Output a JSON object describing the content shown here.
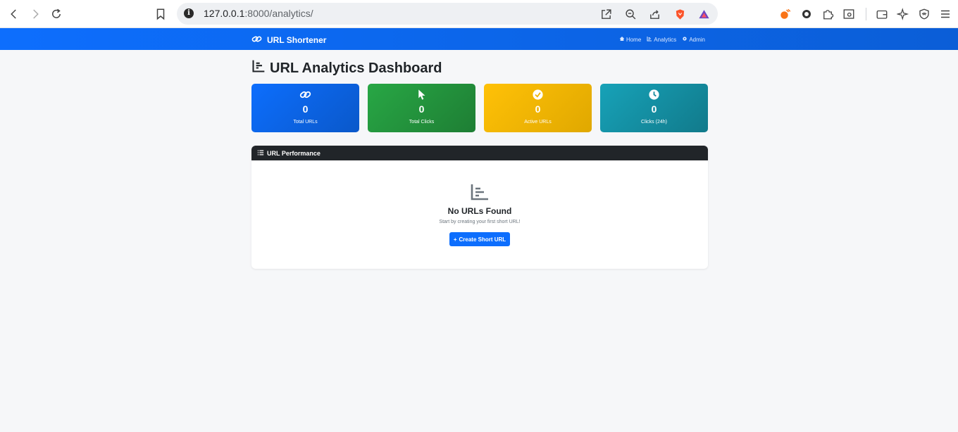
{
  "browser": {
    "url_host": "127.0.0.1",
    "url_path": ":8000/analytics/"
  },
  "navbar": {
    "brand": "URL Shortener",
    "links": [
      "Home",
      "Analytics",
      "Admin"
    ]
  },
  "page": {
    "title": "URL Analytics Dashboard"
  },
  "stats": [
    {
      "value": "0",
      "label": "Total URLs",
      "icon": "link-icon",
      "color": "#0d6efd"
    },
    {
      "value": "0",
      "label": "Total Clicks",
      "icon": "pointer-icon",
      "color": "#28a745"
    },
    {
      "value": "0",
      "label": "Active URLs",
      "icon": "check-circle-icon",
      "color": "#ffc107"
    },
    {
      "value": "0",
      "label": "Clicks (24h)",
      "icon": "clock-icon",
      "color": "#17a2b8"
    }
  ],
  "performance": {
    "header": "URL Performance",
    "empty_title": "No URLs Found",
    "empty_subtitle": "Start by creating your first short URL!",
    "button_label": "Create Short URL"
  }
}
